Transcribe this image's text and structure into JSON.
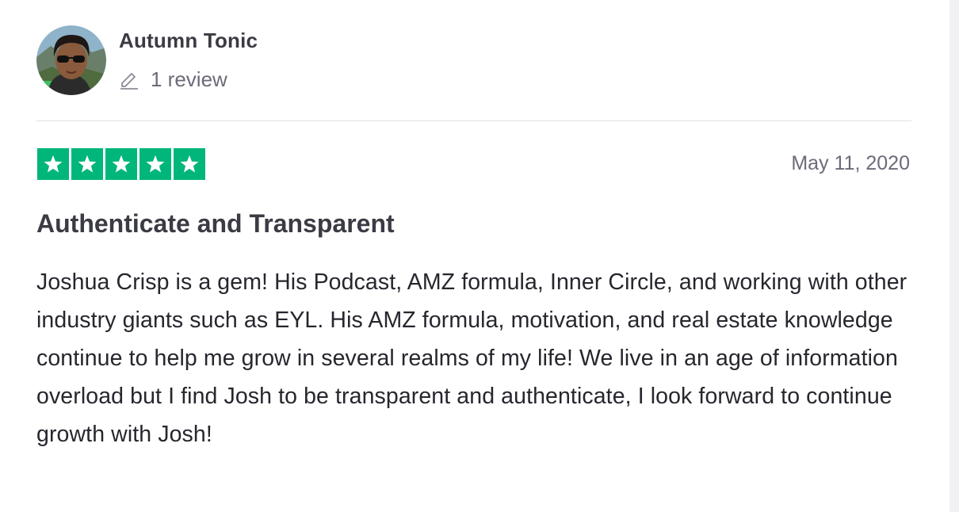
{
  "consumer": {
    "name": "Autumn Tonic",
    "review_count": "1 review",
    "avatar_icon": "user-avatar-photo"
  },
  "review": {
    "rating": 5,
    "max_rating": 5,
    "star_color": "#00b67a",
    "date": "May 11, 2020",
    "title": "Authenticate and Transparent",
    "body": "Joshua Crisp is a gem! His Podcast, AMZ formula, Inner Circle, and working with other industry giants such as EYL. His AMZ formula, motivation, and real estate knowledge continue to help me grow in several realms of my life! We live in an age of information overload but I find Josh to be transparent and authenticate, I look forward to continue growth with Josh!"
  },
  "icons": {
    "review_count_icon": "pencil-icon",
    "star_icon": "star-icon"
  }
}
